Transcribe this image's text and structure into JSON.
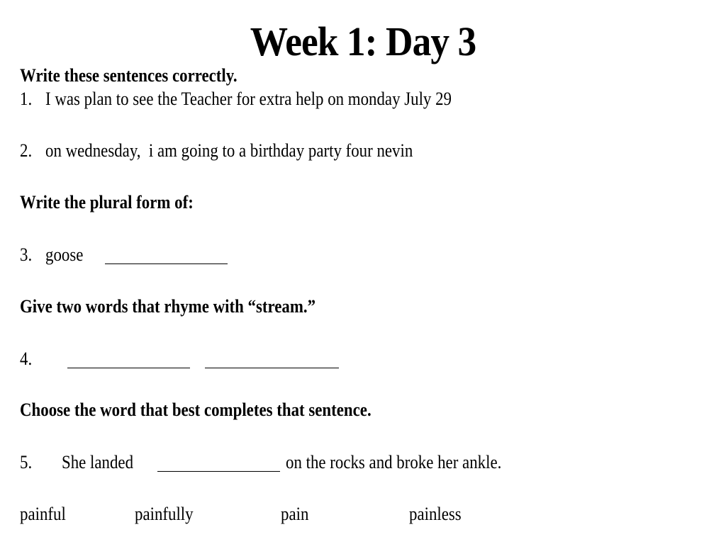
{
  "title": "Week 1: Day 3",
  "sections": {
    "s1": {
      "heading": "Write these sentences correctly.",
      "items": [
        {
          "number": "1.",
          "text": "I was plan to see the Teacher for extra help on monday July 29"
        },
        {
          "number": "2.",
          "text": "on wednesday,  i am going to a birthday party four nevin"
        }
      ]
    },
    "s2": {
      "heading": "Write the plural form of:",
      "item": {
        "number": "3.",
        "word": "goose"
      }
    },
    "s3": {
      "heading": "Give two words that rhyme with “stream.”",
      "item": {
        "number": "4."
      }
    },
    "s4": {
      "heading": "Choose the word that best completes that sentence.",
      "item": {
        "number": "5.",
        "before_blank": "She landed",
        "after_blank": "on the rocks and broke her ankle."
      },
      "choices": [
        "painful",
        "painfully",
        "pain",
        "painless"
      ]
    }
  }
}
